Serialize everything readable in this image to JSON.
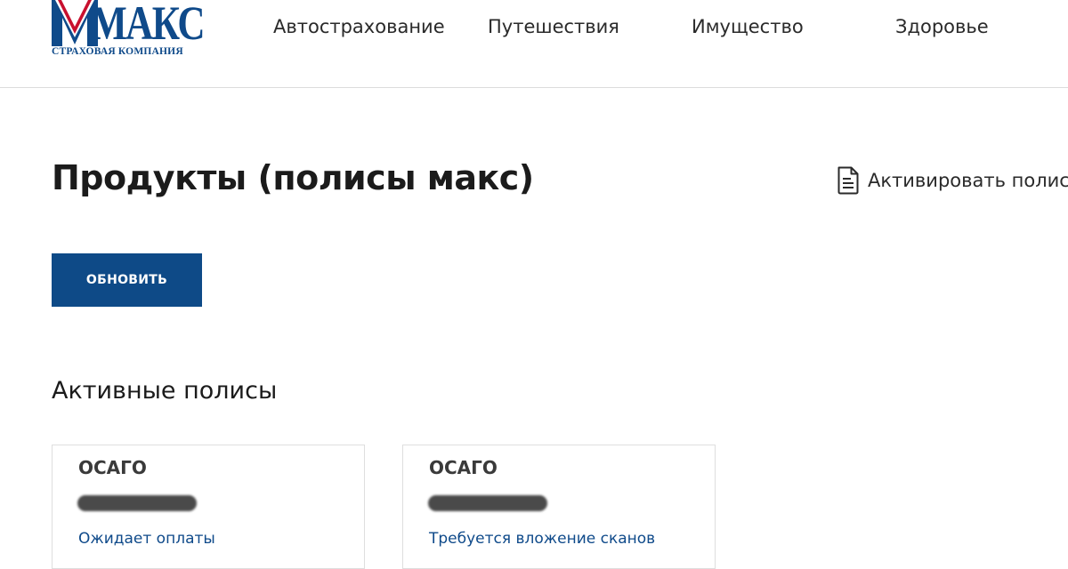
{
  "header": {
    "logo": {
      "wordmark": "МАКС",
      "subtitle": "СТРАХОВАЯ КОМПАНИЯ"
    },
    "nav": [
      {
        "label": "Автострахование"
      },
      {
        "label": "Путешествия"
      },
      {
        "label": "Имущество"
      },
      {
        "label": "Здоровье"
      }
    ]
  },
  "main": {
    "title": "Продукты (полисы макс)",
    "activate": {
      "label": "Активировать полис",
      "icon": "document-icon"
    },
    "refresh_button": "ОБНОВИТЬ",
    "active_section": {
      "title": "Активные полисы",
      "cards": [
        {
          "type": "ОСАГО",
          "status": "Ожидает оплаты"
        },
        {
          "type": "ОСАГО",
          "status": "Требуется вложение сканов"
        }
      ]
    }
  },
  "colors": {
    "brand_blue": "#0e4a87",
    "brand_red": "#c8102e",
    "link_blue": "#0f4a8a",
    "redaction": "#4a4a4a"
  }
}
